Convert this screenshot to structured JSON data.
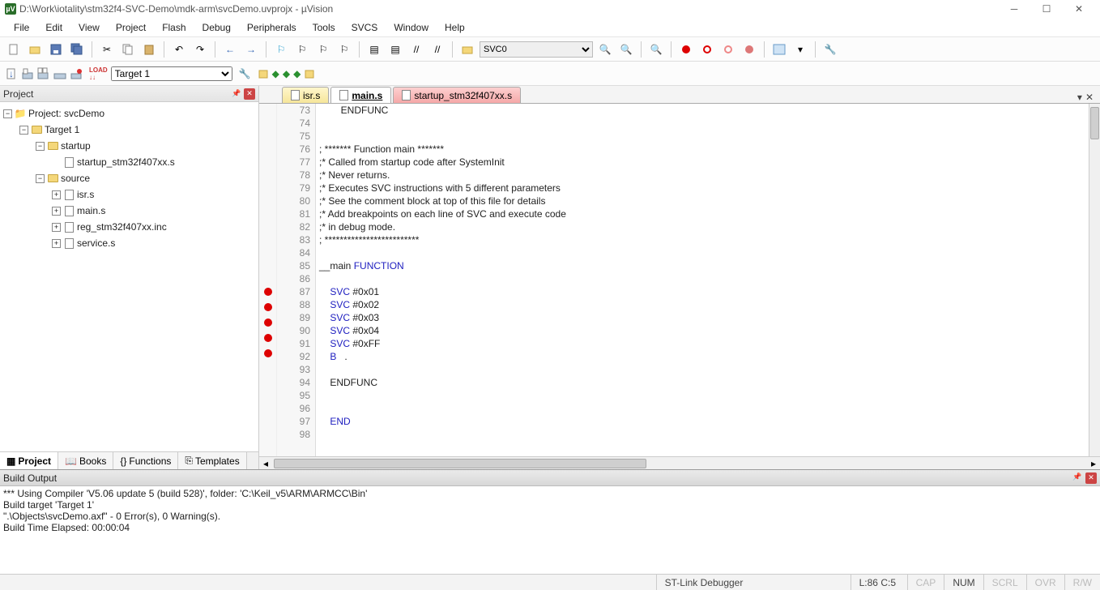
{
  "titlebar": {
    "path": "D:\\Work\\iotality\\stm32f4-SVC-Demo\\mdk-arm\\svcDemo.uvprojx - µVision"
  },
  "menu": [
    "File",
    "Edit",
    "View",
    "Project",
    "Flash",
    "Debug",
    "Peripherals",
    "Tools",
    "SVCS",
    "Window",
    "Help"
  ],
  "toolbar": {
    "target_combo": "SVC0"
  },
  "toolbar2": {
    "target_select": "Target 1"
  },
  "project_panel": {
    "title": "Project",
    "root": "Project: svcDemo",
    "target": "Target 1",
    "group_startup": "startup",
    "startup_file": "startup_stm32f407xx.s",
    "group_source": "source",
    "source_files": [
      "isr.s",
      "main.s",
      "reg_stm32f407xx.inc",
      "service.s"
    ],
    "tabs": [
      "Project",
      "Books",
      "Functions",
      "Templates"
    ]
  },
  "editor": {
    "tabs": [
      {
        "label": "isr.s",
        "style": "yellow"
      },
      {
        "label": "main.s",
        "style": "white",
        "active": true
      },
      {
        "label": "startup_stm32f407xx.s",
        "style": "red"
      }
    ],
    "lines": [
      {
        "n": 73,
        "t": "        ENDFUNC"
      },
      {
        "n": 74,
        "t": ""
      },
      {
        "n": 75,
        "t": ""
      },
      {
        "n": 76,
        "t": "; ******* Function main *******"
      },
      {
        "n": 77,
        "t": ";* Called from startup code after SystemInit"
      },
      {
        "n": 78,
        "t": ";* Never returns."
      },
      {
        "n": 79,
        "t": ";* Executes SVC instructions with 5 different parameters"
      },
      {
        "n": 80,
        "t": ";* See the comment block at top of this file for details"
      },
      {
        "n": 81,
        "t": ";* Add breakpoints on each line of SVC and execute code"
      },
      {
        "n": 82,
        "t": ";* in debug mode."
      },
      {
        "n": 83,
        "t": "; *************************"
      },
      {
        "n": 84,
        "t": ""
      },
      {
        "n": 85,
        "html": "__main <span class='kw'>FUNCTION</span>"
      },
      {
        "n": 86,
        "t": ""
      },
      {
        "n": 87,
        "bp": true,
        "html": "    <span class='kw'>SVC</span> #<span class='num'>0x01</span>"
      },
      {
        "n": 88,
        "bp": true,
        "html": "    <span class='kw'>SVC</span> #<span class='num'>0x02</span>"
      },
      {
        "n": 89,
        "bp": true,
        "html": "    <span class='kw'>SVC</span> #<span class='num'>0x03</span>"
      },
      {
        "n": 90,
        "bp": true,
        "html": "    <span class='kw'>SVC</span> #<span class='num'>0x04</span>"
      },
      {
        "n": 91,
        "bp": true,
        "html": "    <span class='kw'>SVC</span> #<span class='num'>0xFF</span>"
      },
      {
        "n": 92,
        "html": "    <span class='kw'>B</span>   ."
      },
      {
        "n": 93,
        "t": ""
      },
      {
        "n": 94,
        "t": "    ENDFUNC"
      },
      {
        "n": 95,
        "t": ""
      },
      {
        "n": 96,
        "t": ""
      },
      {
        "n": 97,
        "html": "    <span class='kw'>END</span>"
      },
      {
        "n": 98,
        "t": ""
      }
    ]
  },
  "build_output": {
    "title": "Build Output",
    "lines": [
      "*** Using Compiler 'V5.06 update 5 (build 528)', folder: 'C:\\Keil_v5\\ARM\\ARMCC\\Bin'",
      "Build target 'Target 1'",
      "\".\\Objects\\svcDemo.axf\" - 0 Error(s), 0 Warning(s).",
      "Build Time Elapsed:  00:00:04"
    ]
  },
  "statusbar": {
    "debugger": "ST-Link Debugger",
    "cursor": "L:86 C:5",
    "caps": "CAP",
    "num": "NUM",
    "scrl": "SCRL",
    "ovr": "OVR",
    "rw": "R/W"
  }
}
